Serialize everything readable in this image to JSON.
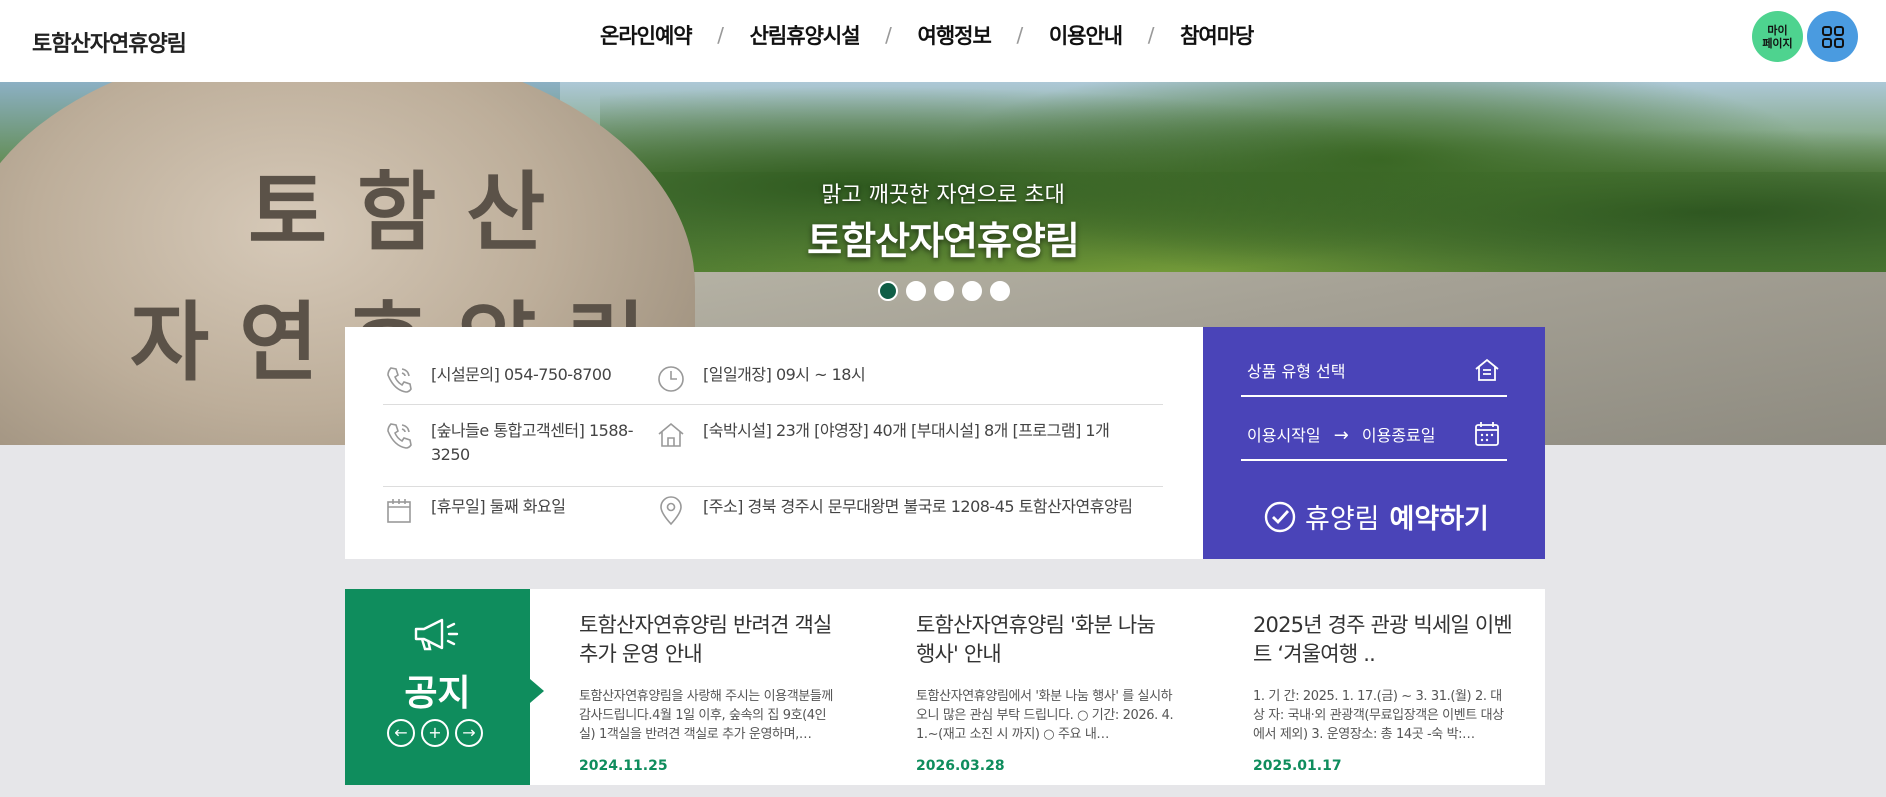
{
  "header": {
    "logo": "토함산자연휴양림",
    "nav": [
      "온라인예약",
      "산림휴양시설",
      "여행정보",
      "이용안내",
      "참여마당"
    ],
    "nav_separator": "/",
    "mypage_label": "마이\n페이지",
    "mypage_color": "#4ed38f",
    "allmenu_color": "#4a9be0",
    "allmenu_icon": "grid-icon"
  },
  "hero": {
    "rock_text_line1": "토함산",
    "rock_text_line2": "자연휴양림",
    "subtitle": "맑고 깨끗한 자연으로 초대",
    "title": "토함산자연휴양림",
    "slides": 5,
    "active_slide": 1
  },
  "info": {
    "phone": "[시설문의] 054-750-8700",
    "hours": "[일일개장] 09시 ~ 18시",
    "callcenter": "[숲나들e 통합고객센터] 1588-3250",
    "facilities": "[숙박시설] 23개 [야영장] 40개 [부대시설] 8개 [프로그램] 1개",
    "closed": "[휴무일] 둘째 화요일",
    "address": "[주소] 경북 경주시 문무대왕면 불국로 1208-45 토함산자연휴양림"
  },
  "booking": {
    "product_type": "상품 유형 선택",
    "date_start": "이용시작일",
    "date_arrow": "→",
    "date_end": "이용종료일",
    "button_prefix": "휴양림",
    "button_bold": "예약하기",
    "bg_color": "#4a44b8"
  },
  "notice": {
    "title": "공지",
    "prev": "←",
    "add": "+",
    "next": "→",
    "color": "#0f8d5d",
    "posts": [
      {
        "title": "토함산자연휴양림 반려견 객실 추가 운영 안내",
        "body": "토함산자연휴양림을 사랑해 주시는 이용객분들께 감사드립니다.4월 1일 이후, 숲속의 집 9호(4인실) 1객실을 반려견 객실로 추가 운영하며,…",
        "date": "2024.11.25"
      },
      {
        "title": "토함산자연휴양림 '화분 나눔 행사' 안내",
        "body": "토함산자연휴양림에서 '화분 나눔 행사' 를 실시하오니 많은 관심 부탁 드립니다. ○ 기간: 2026. 4. 1.~(재고 소진 시 까지) ○ 주요 내…",
        "date": "2026.03.28"
      },
      {
        "title": "2025년 경주 관광 빅세일 이벤트 ‘겨울여행 ..",
        "body": "1. 기 간: 2025. 1. 17.(금) ~ 3. 31.(월)   2. 대 상 자: 국내·외 관광객(무료입장객은 이벤트 대상에서 제외)   3. 운영장소: 총 14곳 -숙 박:…",
        "date": "2025.01.17"
      }
    ]
  }
}
